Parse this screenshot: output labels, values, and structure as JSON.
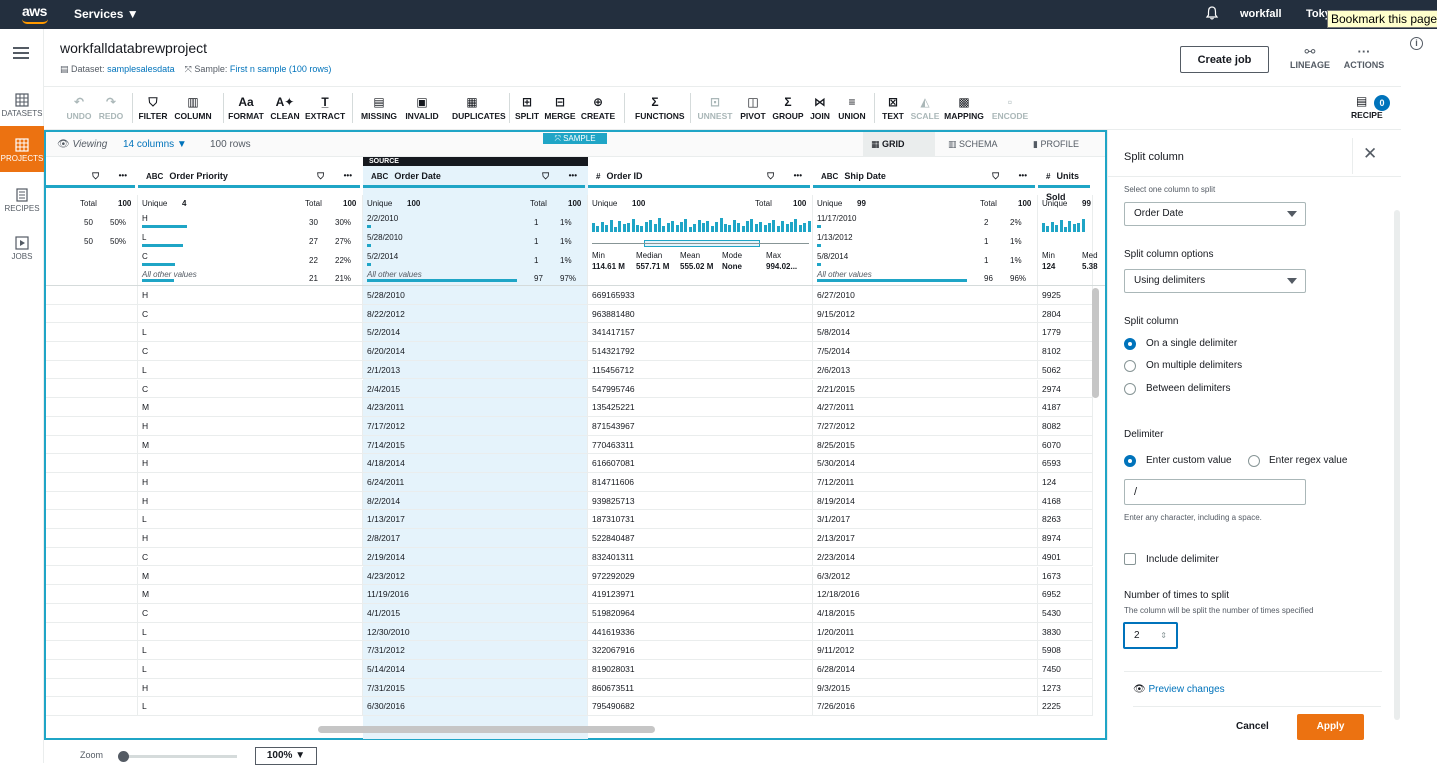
{
  "topnav": {
    "logo": "aws",
    "services": "Services",
    "account": "workfall",
    "region": "Toky",
    "tooltip": "Bookmark this page"
  },
  "sidebar": {
    "items": [
      {
        "label": "DATASETS"
      },
      {
        "label": "PROJECTS",
        "active": true
      },
      {
        "label": "RECIPES"
      },
      {
        "label": "JOBS"
      }
    ]
  },
  "project": {
    "title": "workfalldatabrewproject",
    "dataset_label": "Dataset:",
    "dataset": "samplesalesdata",
    "sample_label": "Sample:",
    "sample": "First n sample (100 rows)"
  },
  "header": {
    "create_job": "Create job",
    "lineage": "LINEAGE",
    "actions": "ACTIONS"
  },
  "toolbar": {
    "items": [
      {
        "label": "UNDO",
        "icon": "↶",
        "disabled": true
      },
      {
        "label": "REDO",
        "icon": "↷",
        "disabled": true
      },
      {
        "label": "FILTER",
        "icon": "⛉"
      },
      {
        "label": "COLUMN",
        "icon": "▥"
      },
      {
        "label": "FORMAT",
        "icon": "Aa"
      },
      {
        "label": "CLEAN",
        "icon": "A✦"
      },
      {
        "label": "EXTRACT",
        "icon": "T̲"
      },
      {
        "label": "MISSING",
        "icon": "▤"
      },
      {
        "label": "INVALID",
        "icon": "▣"
      },
      {
        "label": "DUPLICATES",
        "icon": "▦"
      },
      {
        "label": "SPLIT",
        "icon": "⊞"
      },
      {
        "label": "MERGE",
        "icon": "⊟"
      },
      {
        "label": "CREATE",
        "icon": "⊕"
      },
      {
        "label": "FUNCTIONS",
        "icon": "Σ"
      },
      {
        "label": "UNNEST",
        "icon": "⊡",
        "disabled": true
      },
      {
        "label": "PIVOT",
        "icon": "◫"
      },
      {
        "label": "GROUP",
        "icon": "Σ"
      },
      {
        "label": "JOIN",
        "icon": "⋈"
      },
      {
        "label": "UNION",
        "icon": "≡"
      },
      {
        "label": "TEXT",
        "icon": "⊠"
      },
      {
        "label": "SCALE",
        "icon": "◭",
        "disabled": true
      },
      {
        "label": "MAPPING",
        "icon": "▩"
      },
      {
        "label": "ENCODE",
        "icon": "▫",
        "disabled": true
      }
    ],
    "recipe": "RECIPE",
    "recipe_count": "0"
  },
  "viewbar": {
    "viewing": "Viewing",
    "columns": "14 columns",
    "rows": "100 rows",
    "sample_tag": "SAMPLE",
    "tabs": [
      "GRID",
      "SCHEMA",
      "PROFILE"
    ]
  },
  "grid": {
    "source_tag": "SOURCE",
    "columns": [
      {
        "type": "",
        "name": "",
        "unique": "",
        "total": "100",
        "values": [
          {
            "l": "",
            "c": "50",
            "p": "50%"
          },
          {
            "l": "",
            "c": "50",
            "p": "50%"
          }
        ],
        "other": ""
      },
      {
        "type": "ABC",
        "name": "Order Priority",
        "unique": "4",
        "total": "100",
        "values": [
          {
            "l": "H",
            "c": "30",
            "p": "30%",
            "f": 0.3
          },
          {
            "l": "L",
            "c": "27",
            "p": "27%",
            "f": 0.27
          },
          {
            "l": "C",
            "c": "22",
            "p": "22%",
            "f": 0.22
          }
        ],
        "other": "All other values",
        "other_c": "21",
        "other_p": "21%"
      },
      {
        "type": "ABC",
        "name": "Order Date",
        "unique": "100",
        "total": "100",
        "values": [
          {
            "l": "2/2/2010",
            "c": "1",
            "p": "1%",
            "f": 0.01
          },
          {
            "l": "5/28/2010",
            "c": "1",
            "p": "1%",
            "f": 0.01
          },
          {
            "l": "5/2/2014",
            "c": "1",
            "p": "1%",
            "f": 0.01
          }
        ],
        "other": "All other values",
        "other_c": "97",
        "other_p": "97%"
      },
      {
        "type": "#",
        "name": "Order ID",
        "unique": "100",
        "total": "100",
        "numeric": {
          "min_l": "Min",
          "min": "114.61 M",
          "med_l": "Median",
          "med": "557.71 M",
          "mean_l": "Mean",
          "mean": "555.02 M",
          "mode_l": "Mode",
          "mode": "None",
          "max_l": "Max",
          "max": "994.02..."
        }
      },
      {
        "type": "ABC",
        "name": "Ship Date",
        "unique": "99",
        "total": "100",
        "values": [
          {
            "l": "11/17/2010",
            "c": "2",
            "p": "2%",
            "f": 0.02
          },
          {
            "l": "1/13/2012",
            "c": "1",
            "p": "1%",
            "f": 0.01
          },
          {
            "l": "5/8/2014",
            "c": "1",
            "p": "1%",
            "f": 0.01
          }
        ],
        "other": "All other values",
        "other_c": "96",
        "other_p": "96%"
      },
      {
        "type": "#",
        "name": "Units Sold",
        "unique": "99",
        "total": "",
        "numeric": {
          "min_l": "Min",
          "min": "124",
          "med_l": "Med",
          "med": "5.38"
        }
      }
    ],
    "unique_label": "Unique",
    "total_label": "Total",
    "rows": [
      [
        "H",
        "5/28/2010",
        "669165933",
        "6/27/2010",
        "9925"
      ],
      [
        "C",
        "8/22/2012",
        "963881480",
        "9/15/2012",
        "2804"
      ],
      [
        "L",
        "5/2/2014",
        "341417157",
        "5/8/2014",
        "1779"
      ],
      [
        "C",
        "6/20/2014",
        "514321792",
        "7/5/2014",
        "8102"
      ],
      [
        "L",
        "2/1/2013",
        "115456712",
        "2/6/2013",
        "5062"
      ],
      [
        "C",
        "2/4/2015",
        "547995746",
        "2/21/2015",
        "2974"
      ],
      [
        "M",
        "4/23/2011",
        "135425221",
        "4/27/2011",
        "4187"
      ],
      [
        "H",
        "7/17/2012",
        "871543967",
        "7/27/2012",
        "8082"
      ],
      [
        "M",
        "7/14/2015",
        "770463311",
        "8/25/2015",
        "6070"
      ],
      [
        "H",
        "4/18/2014",
        "616607081",
        "5/30/2014",
        "6593"
      ],
      [
        "H",
        "6/24/2011",
        "814711606",
        "7/12/2011",
        "124"
      ],
      [
        "H",
        "8/2/2014",
        "939825713",
        "8/19/2014",
        "4168"
      ],
      [
        "L",
        "1/13/2017",
        "187310731",
        "3/1/2017",
        "8263"
      ],
      [
        "H",
        "2/8/2017",
        "522840487",
        "2/13/2017",
        "8974"
      ],
      [
        "C",
        "2/19/2014",
        "832401311",
        "2/23/2014",
        "4901"
      ],
      [
        "M",
        "4/23/2012",
        "972292029",
        "6/3/2012",
        "1673"
      ],
      [
        "M",
        "11/19/2016",
        "419123971",
        "12/18/2016",
        "6952"
      ],
      [
        "C",
        "4/1/2015",
        "519820964",
        "4/18/2015",
        "5430"
      ],
      [
        "L",
        "12/30/2010",
        "441619336",
        "1/20/2011",
        "3830"
      ],
      [
        "L",
        "7/31/2012",
        "322067916",
        "9/11/2012",
        "5908"
      ],
      [
        "L",
        "5/14/2014",
        "819028031",
        "6/28/2014",
        "7450"
      ],
      [
        "H",
        "7/31/2015",
        "860673511",
        "9/3/2015",
        "1273"
      ],
      [
        "L",
        "6/30/2016",
        "795490682",
        "7/26/2016",
        "2225"
      ]
    ]
  },
  "panel": {
    "title": "Split column",
    "source_label": "Select one column to split",
    "source_value": "Order Date",
    "options_label": "Split column options",
    "options_value": "Using delimiters",
    "split_label": "Split column",
    "split_options": [
      "On a single delimiter",
      "On multiple delimiters",
      "Between delimiters"
    ],
    "delimiter_label": "Delimiter",
    "delim_custom": "Enter custom value",
    "delim_regex": "Enter regex value",
    "delim_value": "/",
    "delim_help": "Enter any character, including a space.",
    "include_delim": "Include delimiter",
    "times_label": "Number of times to split",
    "times_help": "The column will be split the number of times specified",
    "times_value": "2",
    "preview": "Preview changes",
    "cancel": "Cancel",
    "apply": "Apply"
  },
  "footer": {
    "zoom_label": "Zoom",
    "zoom_value": "100%"
  },
  "colors": {
    "accent": "#1fa5c6",
    "orange": "#ec7211",
    "navy": "#232f3e",
    "link": "#0073bb"
  }
}
